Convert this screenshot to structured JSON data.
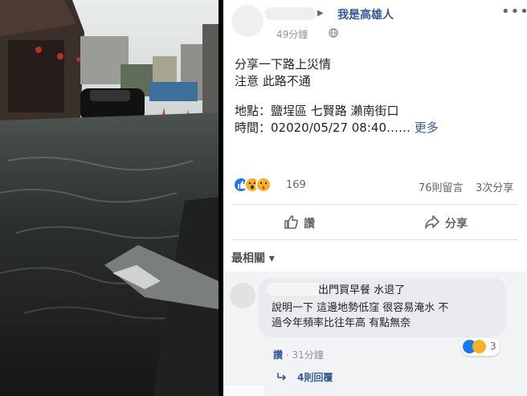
{
  "post": {
    "group_name": "我是高雄人",
    "timestamp": "49分鐘",
    "text_lines": [
      "分享一下路上災情",
      "注意 此路不通"
    ],
    "detail_lines": [
      "地點：鹽埕區 七賢路 瀨南街口",
      "時間：02020/05/27 08:40……"
    ],
    "see_more": "更多"
  },
  "stats": {
    "reaction_count": "169",
    "comments": "76則留言",
    "shares": "3次分享"
  },
  "actions": {
    "like_label": "讚",
    "share_label": "分享"
  },
  "comments": {
    "sort_label": "最相關 ▾",
    "first": {
      "first_line": "出門買早餐 水退了",
      "body_lines": [
        "說明一下 這邊地勢低窪 很容易淹水 不",
        "過今年頻率比往年高 有點無奈"
      ],
      "reaction_count": "3",
      "like_label": "讚",
      "time": "31分鐘",
      "replies": "4則回覆"
    }
  },
  "icons": [
    "globe-icon",
    "more-icon",
    "like-icon",
    "share-icon",
    "reply-arrow-icon"
  ],
  "colors": {
    "link": "#385898",
    "group": "#365899",
    "muted": "#606770",
    "like_blue": "#1877f2",
    "haha_yellow": "#f7b125"
  }
}
